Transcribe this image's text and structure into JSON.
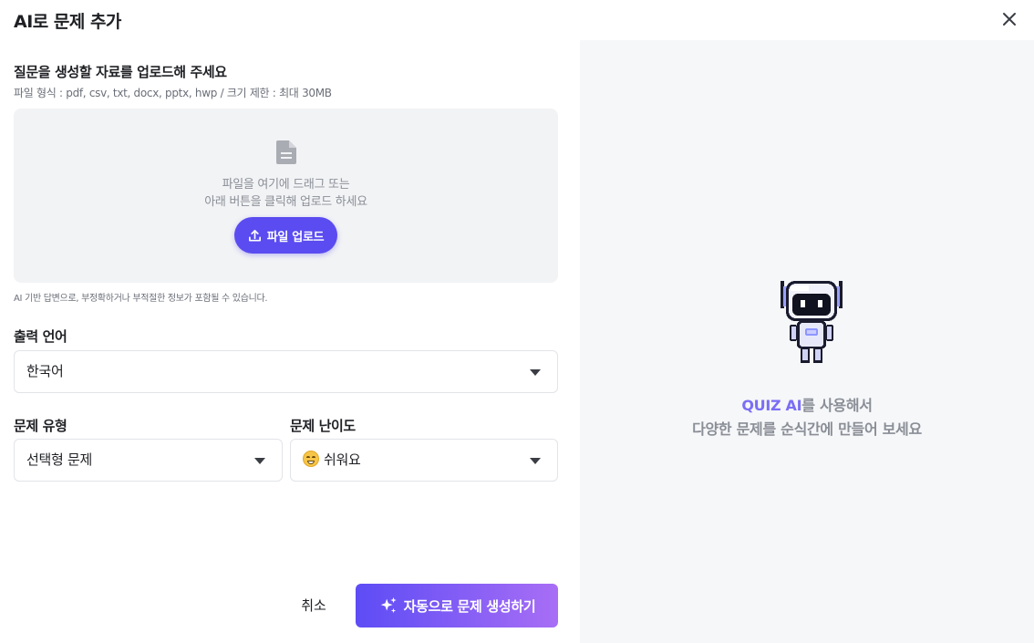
{
  "dialog": {
    "title": "AI로 문제 추가",
    "close_icon": "close-icon"
  },
  "upload": {
    "heading": "질문을 생성할 자료를 업로드해 주세요",
    "format_info": "파일 형식 : pdf, csv, txt, docx, pptx, hwp / 크기 제한 : 최대 30MB",
    "drop_line1": "파일을 여기에 드래그 또는",
    "drop_line2": "아래 버튼을 클릭해 업로드 하세요",
    "button_label": "파일 업로드",
    "icon": "document-icon",
    "disclaimer": "AI 기반 답변으로, 부정확하거나 부적절한 정보가 포함될 수 있습니다."
  },
  "output_language": {
    "label": "출력 언어",
    "value": "한국어"
  },
  "question_type": {
    "label": "문제 유형",
    "value": "선택형 문제"
  },
  "difficulty": {
    "label": "문제 난이도",
    "value": "쉬워요",
    "emoji": "grinning-face-icon"
  },
  "actions": {
    "cancel_label": "취소",
    "generate_label": "자동으로 문제 생성하기",
    "generate_icon": "sparkles-icon"
  },
  "promo": {
    "brand": "QUIZ AI",
    "line1_rest": "를 사용해서",
    "line2": "다양한 문제를 순식간에 만들어 보세요",
    "illustration": "robot-icon"
  },
  "colors": {
    "primary": "#5a4cf0",
    "gradient_end": "#a86ef5",
    "brand_text": "#7a6ef5",
    "panel_bg": "#f6f7f9",
    "dropzone_bg": "#f2f3f5"
  }
}
